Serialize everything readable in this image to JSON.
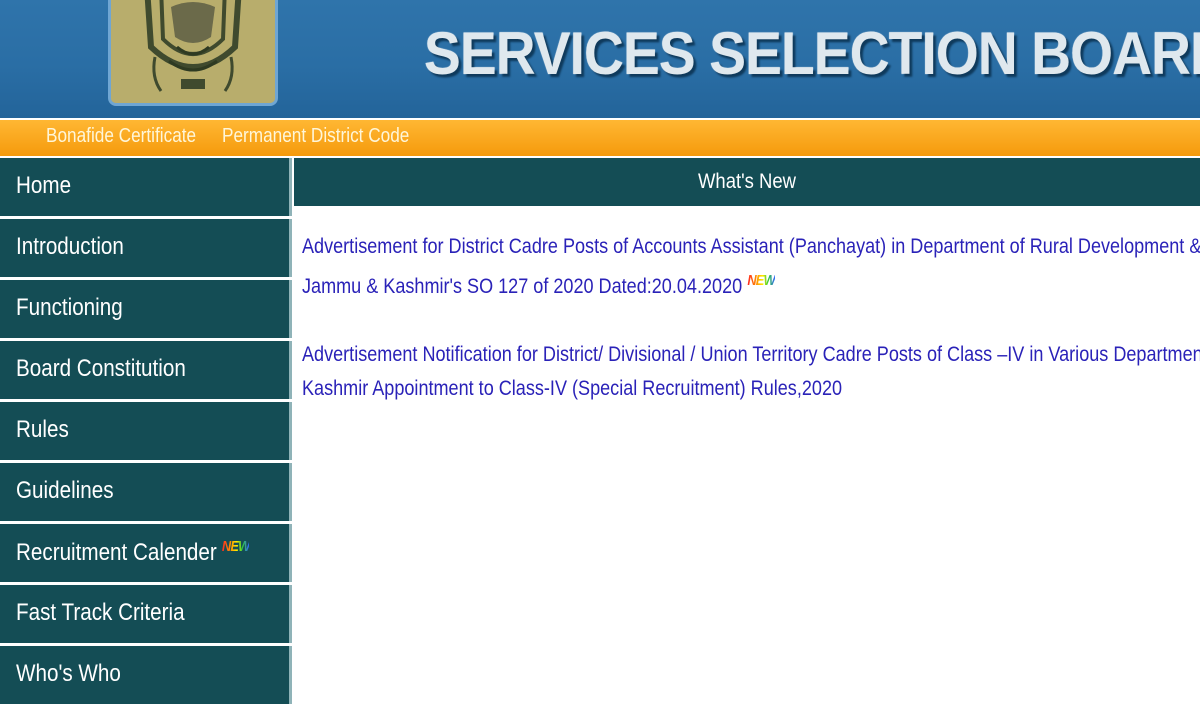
{
  "header": {
    "title": "SERVICES SELECTION BOARD"
  },
  "topbar": {
    "links": [
      "Bonafide Certificate",
      "Permanent District Code"
    ]
  },
  "sidebar": {
    "items": [
      {
        "label": "Home"
      },
      {
        "label": "Introduction"
      },
      {
        "label": "Functioning"
      },
      {
        "label": "Board Constitution"
      },
      {
        "label": "Rules"
      },
      {
        "label": "Guidelines"
      },
      {
        "label": "Recruitment Calender",
        "badge": "NEW"
      },
      {
        "label": "Fast Track Criteria"
      },
      {
        "label": "Who's Who"
      }
    ]
  },
  "main": {
    "section_title": "What's New",
    "news": [
      {
        "line1": "Advertisement for District Cadre Posts of Accounts Assistant (Panchayat) in Department of Rural Development & P",
        "line2": "Jammu & Kashmir's SO 127 of 2020 Dated:20.04.2020",
        "badge": "NEW"
      },
      {
        "line1": "Advertisement Notification for District/ Divisional / Union Territory Cadre Posts of Class –IV in Various Departments",
        "line2": "Kashmir Appointment to Class-IV (Special Recruitment) Rules,2020"
      }
    ]
  },
  "colors": {
    "header_blue": "#2a6ea5",
    "topbar_orange": "#f8a51d",
    "nav_teal": "#144d55",
    "link_blue": "#2a22b8"
  },
  "icons": {
    "emblem": "state-emblem-icon",
    "new": "new-badge-icon"
  }
}
